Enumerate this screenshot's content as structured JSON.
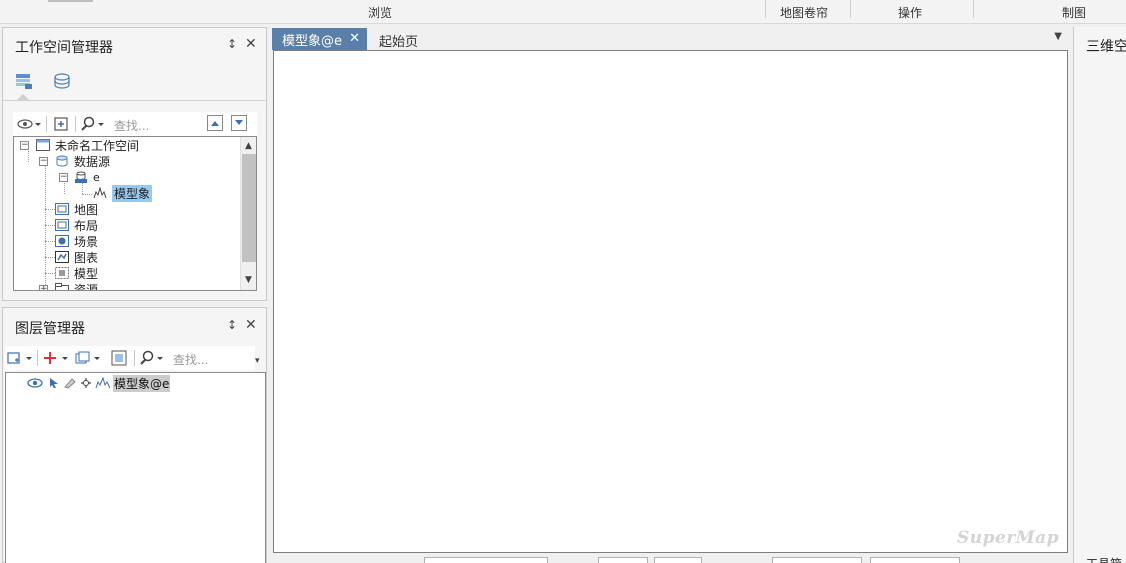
{
  "ribbon": {
    "groups": {
      "browse": "浏览",
      "map_roller": "地图卷帘",
      "operation": "操作",
      "cartography": "制图"
    }
  },
  "workspace_manager": {
    "title": "工作空间管理器",
    "search_placeholder": "查找...",
    "tree": {
      "root": "未命名工作空间",
      "datasources": "数据源",
      "datasource_e": "e",
      "dataset_model": "模型象",
      "maps": "地图",
      "layouts": "布局",
      "scenes": "场景",
      "charts": "图表",
      "models": "模型",
      "resources": "资源"
    }
  },
  "layer_manager": {
    "title": "图层管理器",
    "search_placeholder": "查找...",
    "layer_name": "模型象@e"
  },
  "documents": {
    "active_tab": "模型象@e",
    "tab_start": "起始页",
    "watermark": "SuperMap"
  },
  "right_panel": {
    "title": "三维空",
    "bottom_label": "工具箱"
  },
  "colors": {
    "active_tab": "#5a7fa8",
    "selected_item": "#99c9ef",
    "layer_selected": "#cccccc"
  }
}
